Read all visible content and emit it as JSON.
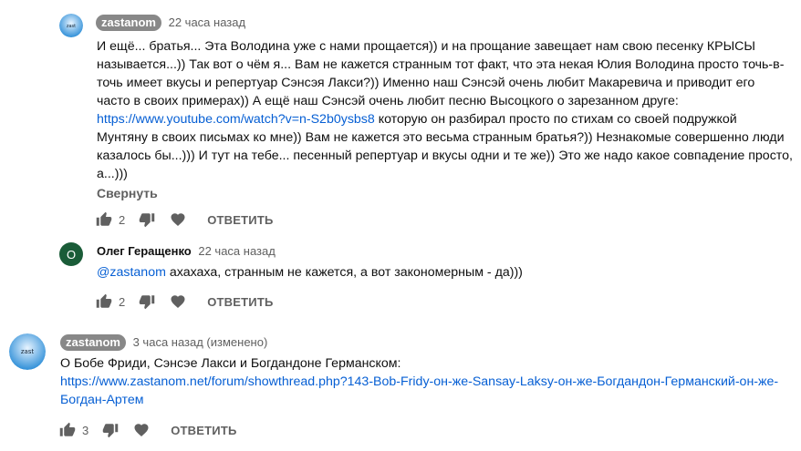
{
  "comments": [
    {
      "author": "zastanom",
      "time": "22 часа назад",
      "lines": [
        {
          "text": "И ещё... братья... Эта Володина уже с нами прощается)) и на прощание завещает нам свою песенку КРЫСЫ"
        },
        {
          "text": "называется...)) Так вот о чём я... Вам не кажется странным тот факт, что эта некая Юлия Володина просто точь-в-"
        },
        {
          "text": "точь имеет вкусы и репертуар Сэнсэя Лакси?)) Именно наш Сэнсэй очень любит Макаревича и приводит его"
        },
        {
          "text": "часто в своих примерах)) А ещё наш Сэнсэй очень любит песню Высоцкого о зарезанном друге:"
        },
        {
          "link": "https://www.youtube.com/watch?v=n-S2b0ysbs8",
          "text": " которую он разбирал просто по стихам со своей подружкой"
        },
        {
          "text": "Мунтяну в своих письмах ко мне)) Вам не кажется это весьма странным братья?)) Незнакомые совершенно люди"
        },
        {
          "text": "казалось бы...))) И тут на тебе... песенный репертуар и вкусы одни и те же)) Это же надо какое совпадение просто,"
        },
        {
          "text": "а...)))"
        }
      ],
      "collapse_label": "Свернуть",
      "likes": "2",
      "reply_label": "ОТВЕТИТЬ"
    },
    {
      "author": "Олег Геращенко",
      "avatar_letter": "О",
      "time": "22 часа назад",
      "mention": "@zastanom",
      "text": " ахахаха, странным не кажется, а вот закономерным - да)))",
      "likes": "2",
      "reply_label": "ОТВЕТИТЬ"
    },
    {
      "author": "zastanom",
      "time": "3 часа назад (изменено)",
      "line1": "О Бобе Фриди, Сэнсэе Лакси и Богдандоне Германском:",
      "link_line1": "https://www.zastanom.net/forum/showthread.php?143-Bob-Fridy-он-же-Sansay-Laksy-он-же-Богдандон-Германский-он-же-",
      "link_line2": "Богдан-Артем",
      "likes": "3",
      "reply_label": "ОТВЕТИТЬ"
    }
  ],
  "colors": {
    "link": "#065fd4",
    "chip": "#888888",
    "avatar_green": "#1a5c38",
    "avatar_blue": "#2f8fd8"
  }
}
